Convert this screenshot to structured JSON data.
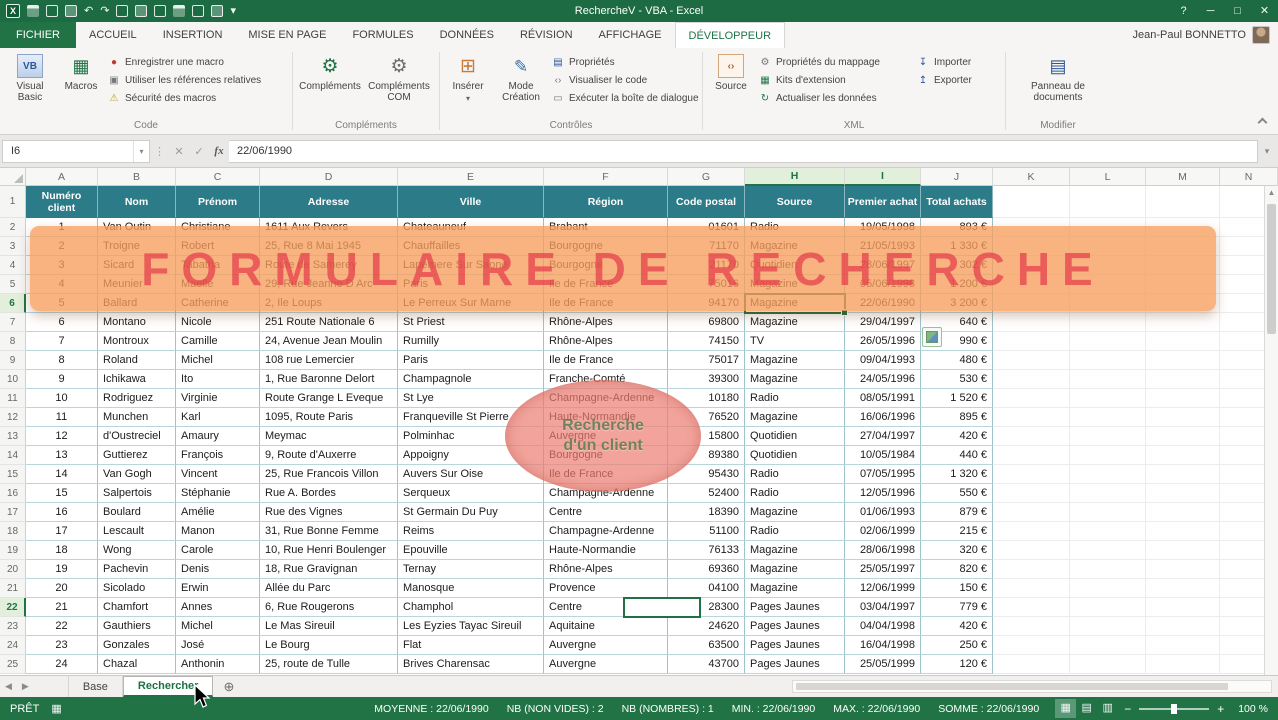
{
  "title_bar": {
    "title": "RechercheV - VBA - Excel"
  },
  "icons": {
    "excel": "X",
    "undo": "↶",
    "redo": "↷",
    "dropdown": "▾",
    "dots": "⋮",
    "vb": "VB",
    "macros": "▦",
    "gear": "⚙",
    "insert": "⊞",
    "design": "✎",
    "source_tag": "‹›",
    "panel": "▤",
    "record": "●",
    "relative": "▣",
    "warning": "⚠",
    "props": "▤",
    "code_tag": "‹›",
    "dialog": "▭",
    "kits": "▦",
    "refresh": "↻",
    "import": "↧",
    "export": "↥",
    "fx": "fx",
    "cancel": "✕",
    "enter": "✓",
    "help": "?",
    "minimize": "─",
    "maximize": "□",
    "close": "✕",
    "nav_left": "◀",
    "nav_right": "▶",
    "plus_sheet": "⊕",
    "minus": "−",
    "plus": "+",
    "grid_view": "▦",
    "layout_view": "▤",
    "break_view": "▥",
    "macro_status": "▦",
    "scroll_up": "▲"
  },
  "ribbon": {
    "tabs": {
      "fichier": "FICHIER",
      "accueil": "ACCUEIL",
      "insertion": "INSERTION",
      "mise_en_page": "MISE EN PAGE",
      "formules": "FORMULES",
      "donnees": "DONNÉES",
      "revision": "RÉVISION",
      "affichage": "AFFICHAGE",
      "developpeur": "DÉVELOPPEUR"
    },
    "user_name": "Jean-Paul BONNETTO",
    "code": {
      "visual_basic": "Visual Basic",
      "macros": "Macros",
      "record": "Enregistrer une macro",
      "relative": "Utiliser les références relatives",
      "security": "Sécurité des macros",
      "label": "Code"
    },
    "complements": {
      "addins": "Compléments",
      "com": "Compléments COM",
      "label": "Compléments"
    },
    "controles": {
      "inserer": "Insérer",
      "mode": "Mode Création",
      "proprietes": "Propriétés",
      "code": "Visualiser le code",
      "dialog": "Exécuter la boîte de dialogue",
      "label": "Contrôles"
    },
    "xml": {
      "source": "Source",
      "map": "Propriétés du mappage",
      "kits": "Kits d'extension",
      "refresh": "Actualiser les données",
      "importer": "Importer",
      "exporter": "Exporter",
      "label": "XML"
    },
    "modifier": {
      "panel": "Panneau de documents",
      "label": "Modifier"
    }
  },
  "formula_bar": {
    "name_box": "I6",
    "value": "22/06/1990"
  },
  "grid": {
    "column_letters": [
      "A",
      "B",
      "C",
      "D",
      "E",
      "F",
      "G",
      "H",
      "I",
      "J",
      "K",
      "L",
      "M",
      "N"
    ],
    "highlighted_columns": [
      "H",
      "I"
    ],
    "row_numbers": [
      "1",
      "2",
      "3",
      "4",
      "5",
      "6",
      "7",
      "8",
      "9",
      "10",
      "11",
      "12",
      "13",
      "14",
      "15",
      "16",
      "17",
      "18",
      "19",
      "20",
      "21",
      "22",
      "23",
      "24",
      "25"
    ],
    "highlighted_rows": [
      "6",
      "22"
    ],
    "table": {
      "headers": [
        "Numéro client",
        "Nom",
        "Prénom",
        "Adresse",
        "Ville",
        "Région",
        "Code postal",
        "Source",
        "Premier achat",
        "Total achats"
      ],
      "rows": [
        [
          "1",
          "Van Outin",
          "Christiane",
          "1611 Aux Revers",
          "Chateauneuf",
          "Brabant",
          "01601",
          "Radio",
          "19/05/1998",
          "893 €"
        ],
        [
          "2",
          "Troigne",
          "Robert",
          "25, Rue 8 Mai 1945",
          "Chauffailles",
          "Bourgogne",
          "71170",
          "Magazine",
          "21/05/1993",
          "1 330 €"
        ],
        [
          "3",
          "Sicard",
          "Tabatha",
          "Route de Samerey",
          "Lapemere Sur Saone",
          "Bourgogne",
          "21170",
          "Quotidien",
          "28/06/1997",
          "302 €"
        ],
        [
          "4",
          "Meunier",
          "Maelle",
          "29, Rue Jeanne D Arc",
          "Paris",
          "Ile de France",
          "75016",
          "Magazine",
          "05/06/1998",
          "1 200 €"
        ],
        [
          "5",
          "Ballard",
          "Catherine",
          "2, Ile Loups",
          "Le Perreux Sur Marne",
          "Ile de France",
          "94170",
          "Magazine",
          "22/06/1990",
          "3 200 €"
        ],
        [
          "6",
          "Montano",
          "Nicole",
          "251 Route Nationale 6",
          "St Priest",
          "Rhône-Alpes",
          "69800",
          "Magazine",
          "29/04/1997",
          "640 €"
        ],
        [
          "7",
          "Montroux",
          "Camille",
          "24, Avenue Jean Moulin",
          "Rumilly",
          "Rhône-Alpes",
          "74150",
          "TV",
          "26/05/1996",
          "990 €"
        ],
        [
          "8",
          "Roland",
          "Michel",
          "108 rue Lemercier",
          "Paris",
          "Ile de France",
          "75017",
          "Magazine",
          "09/04/1993",
          "480 €"
        ],
        [
          "9",
          "Ichikawa",
          "Ito",
          "1, Rue Baronne Delort",
          "Champagnole",
          "Franche-Comté",
          "39300",
          "Magazine",
          "24/05/1996",
          "530 €"
        ],
        [
          "10",
          "Rodriguez",
          "Virginie",
          "Route Grange L Eveque",
          "St Lye",
          "Champagne-Ardenne",
          "10180",
          "Radio",
          "08/05/1991",
          "1 520 €"
        ],
        [
          "11",
          "Munchen",
          "Karl",
          "1095, Route Paris",
          "Franqueville St Pierre",
          "Haute-Normandie",
          "76520",
          "Magazine",
          "16/06/1996",
          "895 €"
        ],
        [
          "12",
          "d'Oustreciel",
          "Amaury",
          "Meymac",
          "Polminhac",
          "Auvergne",
          "15800",
          "Quotidien",
          "27/04/1997",
          "420 €"
        ],
        [
          "13",
          "Guttierez",
          "François",
          "9, Route d'Auxerre",
          "Appoigny",
          "Bourgogne",
          "89380",
          "Quotidien",
          "10/05/1984",
          "440 €"
        ],
        [
          "14",
          "Van Gogh",
          "Vincent",
          "25, Rue Francois Villon",
          "Auvers Sur Oise",
          "Ile de France",
          "95430",
          "Radio",
          "07/05/1995",
          "1 320 €"
        ],
        [
          "15",
          "Salpertois",
          "Stéphanie",
          "Rue A. Bordes",
          "Serqueux",
          "Champagne-Ardenne",
          "52400",
          "Radio",
          "12/05/1996",
          "550 €"
        ],
        [
          "16",
          "Boulard",
          "Amélie",
          "Rue des Vignes",
          "St Germain Du Puy",
          "Centre",
          "18390",
          "Magazine",
          "01/06/1993",
          "879 €"
        ],
        [
          "17",
          "Lescault",
          "Manon",
          "31, Rue Bonne Femme",
          "Reims",
          "Champagne-Ardenne",
          "51100",
          "Radio",
          "02/06/1999",
          "215 €"
        ],
        [
          "18",
          "Wong",
          "Carole",
          "10, Rue Henri Boulenger",
          "Epouville",
          "Haute-Normandie",
          "76133",
          "Magazine",
          "28/06/1998",
          "320 €"
        ],
        [
          "19",
          "Pachevin",
          "Denis",
          "18, Rue Gravignan",
          "Ternay",
          "Rhône-Alpes",
          "69360",
          "Magazine",
          "25/05/1997",
          "820 €"
        ],
        [
          "20",
          "Sicolado",
          "Erwin",
          "Allée du Parc",
          "Manosque",
          "Provence",
          "04100",
          "Magazine",
          "12/06/1999",
          "150 €"
        ],
        [
          "21",
          "Chamfort",
          "Annes",
          "6, Rue Rougerons",
          "Champhol",
          "Centre",
          "28300",
          "Pages Jaunes",
          "03/04/1997",
          "779 €"
        ],
        [
          "22",
          "Gauthiers",
          "Michel",
          "Le Mas Sireuil",
          "Les Eyzies Tayac Sireuil",
          "Aquitaine",
          "24620",
          "Pages Jaunes",
          "04/04/1998",
          "420 €"
        ],
        [
          "23",
          "Gonzales",
          "José",
          "Le Bourg",
          "Flat",
          "Auvergne",
          "63500",
          "Pages Jaunes",
          "16/04/1998",
          "250 €"
        ],
        [
          "24",
          "Chazal",
          "Anthonin",
          "25, route de Tulle",
          "Brives Charensac",
          "Auvergne",
          "43700",
          "Pages Jaunes",
          "25/05/1999",
          "120 €"
        ]
      ]
    }
  },
  "overlays": {
    "banner": "FORMULAIRE DE RECHERCHE",
    "ellipse_line1": "Recherche",
    "ellipse_line2": "d'un client"
  },
  "sheet_bar": {
    "base": "Base",
    "rechercher": "Rechercher"
  },
  "status_bar": {
    "ready": "PRÊT",
    "stats": [
      "MOYENNE : 22/06/1990",
      "NB (NON VIDES) : 2",
      "NB (NOMBRES) : 1",
      "MIN. : 22/06/1990",
      "MAX. : 22/06/1990",
      "SOMME : 22/06/1990"
    ],
    "zoom": "100 %"
  }
}
